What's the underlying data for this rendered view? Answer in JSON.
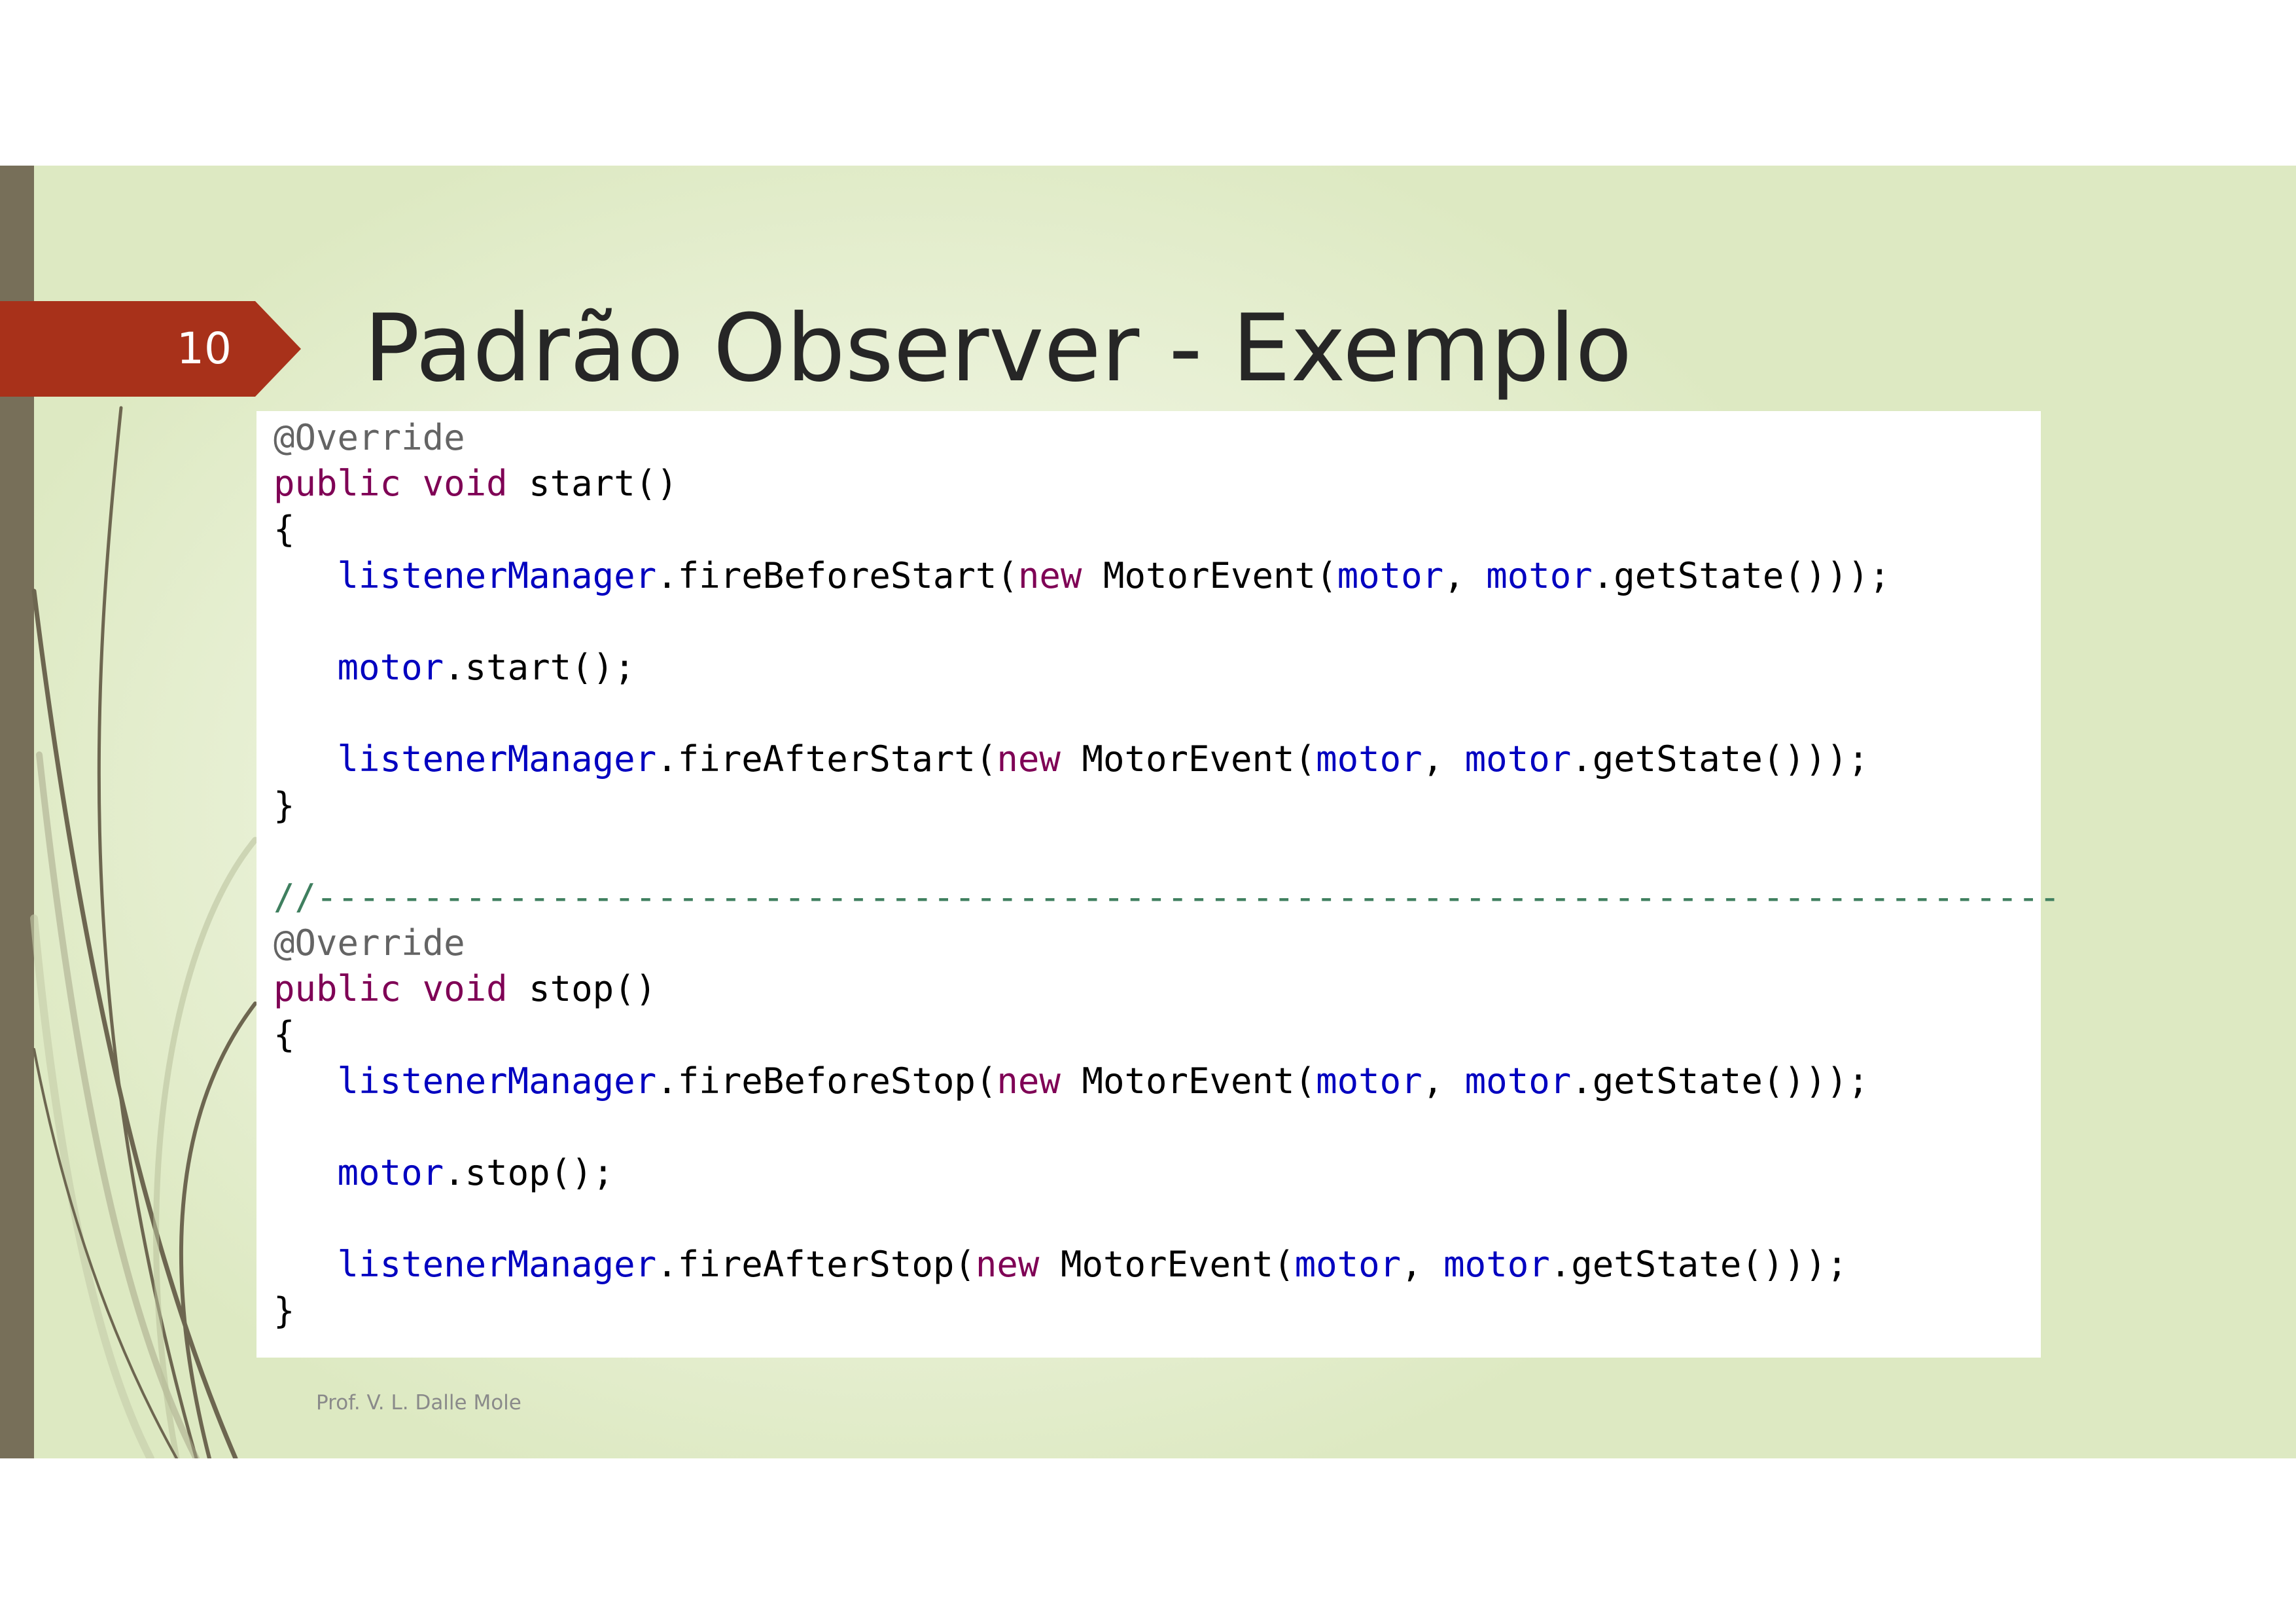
{
  "slide": {
    "number": "10",
    "title": "Padrão Observer - Exemplo",
    "footer": "Prof. V. L. Dalle Mole"
  },
  "code": {
    "lines": [
      [
        {
          "t": "@Override",
          "c": "ann"
        }
      ],
      [
        {
          "t": "public",
          "c": "kw"
        },
        {
          "t": " "
        },
        {
          "t": "void",
          "c": "kw"
        },
        {
          "t": " start()"
        }
      ],
      [
        {
          "t": "{"
        }
      ],
      [
        {
          "t": "   "
        },
        {
          "t": "listenerManager",
          "c": "fld"
        },
        {
          "t": ".fireBeforeStart("
        },
        {
          "t": "new",
          "c": "kw"
        },
        {
          "t": " MotorEvent("
        },
        {
          "t": "motor",
          "c": "fld"
        },
        {
          "t": ", "
        },
        {
          "t": "motor",
          "c": "fld"
        },
        {
          "t": ".getState()));"
        }
      ],
      [],
      [
        {
          "t": "   "
        },
        {
          "t": "motor",
          "c": "fld"
        },
        {
          "t": ".start();"
        }
      ],
      [],
      [
        {
          "t": "   "
        },
        {
          "t": "listenerManager",
          "c": "fld"
        },
        {
          "t": ".fireAfterStart("
        },
        {
          "t": "new",
          "c": "kw"
        },
        {
          "t": " MotorEvent("
        },
        {
          "t": "motor",
          "c": "fld"
        },
        {
          "t": ", "
        },
        {
          "t": "motor",
          "c": "fld"
        },
        {
          "t": ".getState()));"
        }
      ],
      [
        {
          "t": "}"
        }
      ],
      [],
      [
        {
          "t": "//----------------------------------------------------------------------------------",
          "c": "cmt"
        }
      ],
      [
        {
          "t": "@Override",
          "c": "ann"
        }
      ],
      [
        {
          "t": "public",
          "c": "kw"
        },
        {
          "t": " "
        },
        {
          "t": "void",
          "c": "kw"
        },
        {
          "t": " stop()"
        }
      ],
      [
        {
          "t": "{"
        }
      ],
      [
        {
          "t": "   "
        },
        {
          "t": "listenerManager",
          "c": "fld"
        },
        {
          "t": ".fireBeforeStop("
        },
        {
          "t": "new",
          "c": "kw"
        },
        {
          "t": " MotorEvent("
        },
        {
          "t": "motor",
          "c": "fld"
        },
        {
          "t": ", "
        },
        {
          "t": "motor",
          "c": "fld"
        },
        {
          "t": ".getState()));"
        }
      ],
      [],
      [
        {
          "t": "   "
        },
        {
          "t": "motor",
          "c": "fld"
        },
        {
          "t": ".stop();"
        }
      ],
      [],
      [
        {
          "t": "   "
        },
        {
          "t": "listenerManager",
          "c": "fld"
        },
        {
          "t": ".fireAfterStop("
        },
        {
          "t": "new",
          "c": "kw"
        },
        {
          "t": " MotorEvent("
        },
        {
          "t": "motor",
          "c": "fld"
        },
        {
          "t": ", "
        },
        {
          "t": "motor",
          "c": "fld"
        },
        {
          "t": ".getState()));"
        }
      ],
      [
        {
          "t": "}"
        }
      ]
    ]
  },
  "colors": {
    "badge": "#a8311a",
    "left_bar": "#776f59",
    "keyword": "#7f0055",
    "field": "#0000c0",
    "annotation": "#646464",
    "comment": "#3f7f5f"
  }
}
